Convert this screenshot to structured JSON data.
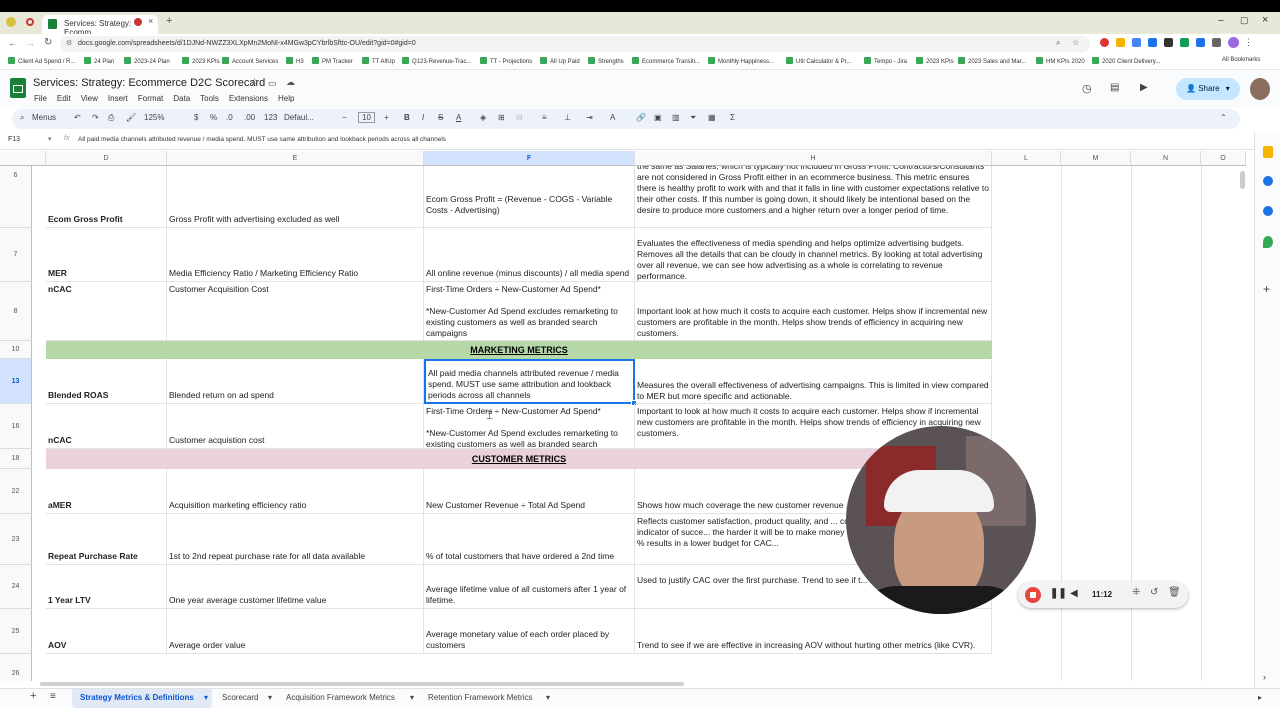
{
  "browser": {
    "tab_title": "Services: Strategy: Ecomm",
    "url": "docs.google.com/spreadsheets/d/1DJNd-NWZZ3XLXpMn2MoNI-x4MGw3pCYbrlbSfttc-OU/edit?gid=0#gid=0",
    "bookmarks": [
      "Client Ad Spend / R...",
      "24 Plan",
      "2023-24 Plan",
      "2023 KPIs",
      "Account Services",
      "H3",
      "PM Tracker",
      "TT AllUp",
      "Q123-Revenue-Trac...",
      "TT - Projections",
      "All Up Paid",
      "Strengths",
      "Ecommerce Transiti...",
      "Monthly Happiness...",
      "Util Calculator & Pr...",
      "Tempo - Jira",
      "2023 KPIs",
      "2023 Sales and Mar...",
      "HM KPIs 2020",
      "2020 Client Delivery..."
    ],
    "all_bookmarks": "All Bookmarks"
  },
  "app": {
    "doc_title": "Services: Strategy: Ecommerce D2C Scorecard",
    "menus": [
      "File",
      "Edit",
      "View",
      "Insert",
      "Format",
      "Data",
      "Tools",
      "Extensions",
      "Help"
    ],
    "share_label": "Share"
  },
  "toolbar": {
    "menus_label": "Menus",
    "zoom": "125%",
    "currency": "$",
    "percent": "%",
    "dec_less": ".0",
    "dec_more": ".00",
    "number_format": "123",
    "font": "Defaul...",
    "font_size": "10"
  },
  "formula_bar": {
    "cell_ref": "F13",
    "fx": "fx",
    "content": "All paid media channels attributed revenue / media spend. MUST use same attribution and lookback periods across all channels"
  },
  "columns": [
    "D",
    "E",
    "F",
    "H",
    "L",
    "M",
    "N",
    "O"
  ],
  "rows": [
    {
      "num": "6",
      "metric": "Ecom Gross Profit",
      "desc": "Gross Profit with advertising excluded as well",
      "formula": "Ecom Gross Profit = (Revenue - COGS - Variable Costs - Advertising)",
      "notes": "the same as Salaries, which is typically not included in Gross Profit. Contractors/Consultants are not considered in Gross Profit either in an ecommerce business. This metric ensures there is healthy profit to work with and that it falls in line with customer expectations relative to their other costs. If this number is going down, it should likely be intentional based on the desire to produce more customers and a higher return over a longer period of time."
    },
    {
      "num": "7",
      "metric": "MER",
      "desc": "Media Efficiency Ratio / Marketing Efficiency Ratio",
      "formula": "All online revenue (minus discounts) / all media spend",
      "notes": "Evaluates the effectiveness of media spending and helps optimize advertising budgets. Removes all the details that can be cloudy in channel metrics. By looking at total advertising over all revenue, we can see how advertising as a whole is correlating to revenue performance."
    },
    {
      "num": "8",
      "metric": "nCAC",
      "desc": "Customer Acquisition Cost",
      "formula": "First-Time Orders ÷ New-Customer Ad Spend*\n\n*New-Customer Ad Spend excludes remarketing to existing customers as well as branded search campaigns",
      "notes": "Important look at how much it costs to acquire each customer. Helps show if incremental new customers are profitable in the month. Helps show trends of efficiency in acquiring new customers."
    },
    {
      "num": "10",
      "band": "MARKETING METRICS"
    },
    {
      "num": "13",
      "metric": "Blended ROAS",
      "desc": "Blended return on ad spend",
      "formula": "All paid media channels attributed revenue / media spend. MUST use same attribution and lookback periods across all channels",
      "notes": "Measures the overall effectiveness of advertising campaigns. This is limited in view compared to MER but more specific and actionable."
    },
    {
      "num": "16",
      "metric": "nCAC",
      "desc": "Customer acquistion cost",
      "formula": "First-Time Orders ÷ New-Customer Ad Spend*\n\n*New-Customer Ad Spend excludes remarketing to existing customers as well as branded search",
      "notes": "Important to look at how much it costs to acquire each customer. Helps show if incremental new customers are profitable in the month. Helps show trends of efficiency in acquiring new customers."
    },
    {
      "num": "18",
      "band": "CUSTOMER METRICS"
    },
    {
      "num": "22",
      "metric": "aMER",
      "desc": "Acquisition marketing efficiency ratio",
      "formula": "New Customer Revenue ÷ Total Ad Spend",
      "notes": "Shows how much coverage the new customer revenue ... media spend."
    },
    {
      "num": "23",
      "metric": "Repeat Purchase Rate",
      "desc": "1st to 2nd repeat purchase rate for all data available",
      "formula": "% of total customers that have ordered a 2nd time",
      "notes": "Reflects customer satisfaction, product quality, and ... customer relationships. Long-term indicator of succe... the harder it will be to make money over the LTV of a... marketing. Lower % results in a lower budget for CAC..."
    },
    {
      "num": "24",
      "metric": "1 Year LTV",
      "desc": "One year average customer lifetime value",
      "formula": "Average lifetime value of all customers after 1 year of lifetime.",
      "notes": "Used to justify CAC over the first purchase. Trend to see if t... LTV over time."
    },
    {
      "num": "25",
      "metric": "AOV",
      "desc": "Average order value",
      "formula": "Average monetary value of each order placed by customers",
      "notes": "Trend to see if we are effective in increasing AOV without hurting other metrics (like CVR)."
    },
    {
      "num": "26"
    }
  ],
  "recorder": {
    "time": "11:12"
  },
  "sheet_tabs": [
    "Strategy Metrics & Definitions",
    "Scorecard",
    "Acquisition Framework Metrics",
    "Retention Framework Metrics"
  ],
  "colors": {
    "marketing_band": "#b6d7a8",
    "customer_band": "#ead1dc",
    "selection": "#1a73e8",
    "recorder_stop": "#e8453c"
  }
}
